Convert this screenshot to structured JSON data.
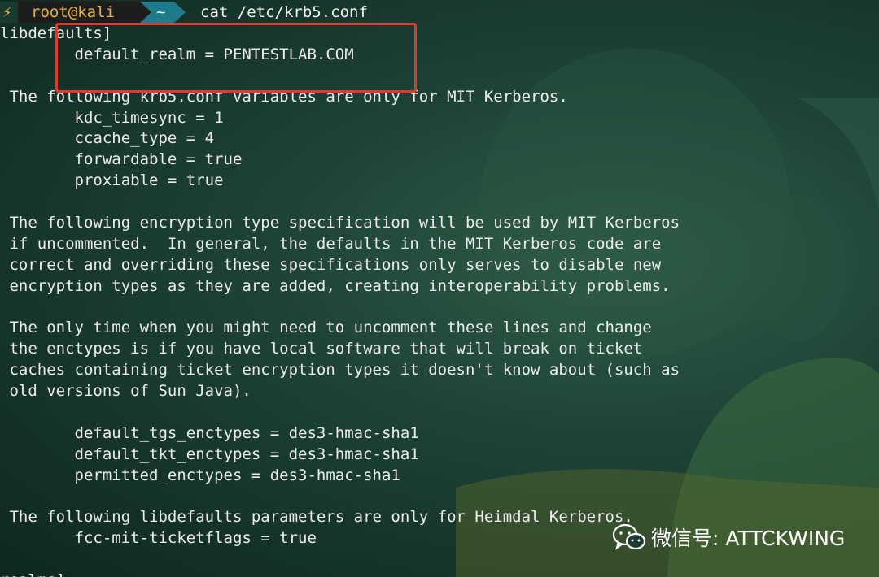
{
  "prompt": {
    "bolt_glyph": "⚡",
    "user_host": "root@kali",
    "directory": "~",
    "command": "cat /etc/krb5.conf"
  },
  "file_lines": [
    "libdefaults]",
    "        default_realm = PENTESTLAB.COM",
    "",
    " The following krb5.conf variables are only for MIT Kerberos.",
    "        kdc_timesync = 1",
    "        ccache_type = 4",
    "        forwardable = true",
    "        proxiable = true",
    "",
    " The following encryption type specification will be used by MIT Kerberos",
    " if uncommented.  In general, the defaults in the MIT Kerberos code are",
    " correct and overriding these specifications only serves to disable new",
    " encryption types as they are added, creating interoperability problems.",
    "",
    " The only time when you might need to uncomment these lines and change",
    " the enctypes is if you have local software that will break on ticket",
    " caches containing ticket encryption types it doesn't know about (such as",
    " old versions of Sun Java).",
    "",
    "        default_tgs_enctypes = des3-hmac-sha1",
    "        default_tkt_enctypes = des3-hmac-sha1",
    "        permitted_enctypes = des3-hmac-sha1",
    "",
    " The following libdefaults parameters are only for Heimdal Kerberos.",
    "        fcc-mit-ticketflags = true",
    "",
    "realms]"
  ],
  "watermark": {
    "icon": "wechat-icon",
    "text": "微信号: ATTCKWING"
  },
  "colors": {
    "highlight_box": "#e8362a",
    "prompt_user": "#e8b23a",
    "prompt_dir_bg": "#1f7a8c",
    "terminal_text": "#ececec"
  }
}
